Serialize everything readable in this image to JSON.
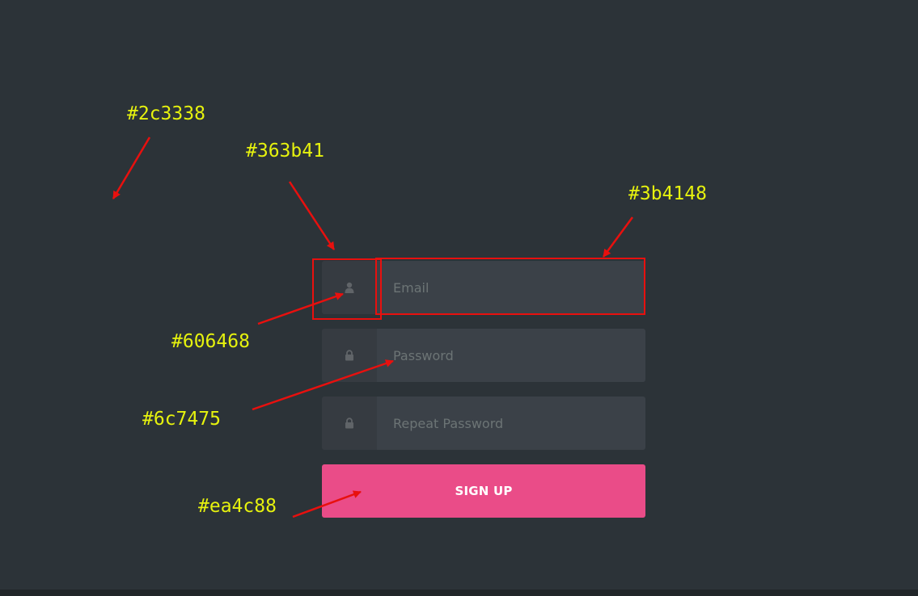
{
  "form": {
    "email_placeholder": "Email",
    "password_placeholder": "Password",
    "repeat_password_placeholder": "Repeat Password",
    "submit_label": "SIGN UP",
    "icons": [
      "user-icon",
      "lock-icon",
      "lock-icon"
    ]
  },
  "annotations": {
    "background": "#2c3338",
    "icon_cell": "#363b41",
    "input_field": "#3b4148",
    "icon_color": "#606468",
    "placeholder_text": "#6c7475",
    "button": "#ea4c88"
  },
  "colors": {
    "page_background": "#2c3338",
    "icon_cell_background": "#363b41",
    "input_background": "#3b4148",
    "icon_color": "#606468",
    "placeholder_color": "#6c7475",
    "button_color": "#ea4c88",
    "button_text": "#ffffff",
    "annotation_text": "#e6f20e",
    "annotation_arrow": "#e8100e"
  }
}
